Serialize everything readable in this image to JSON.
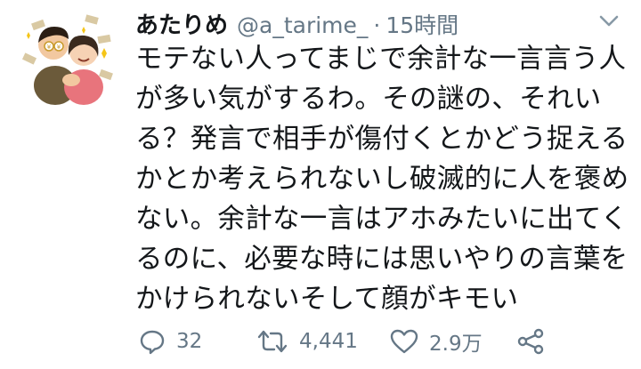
{
  "user": {
    "display_name": "あたりめ",
    "handle": "@a_tarime_",
    "separator": "·",
    "time": "15時間"
  },
  "tweet": {
    "lines": [
      "モテない人ってまじで余計な一言言う人",
      "が多い気がするわ。その謎の、それい",
      "る？発言で相手が傷付くとかどう捉える",
      "かとか考えられないし破滅的に人を褒め",
      "ない。余計な一言はアホみたいに出てく",
      "るのに、必要な時には思いやりの言葉を",
      "かけられないそして顔がキモい"
    ]
  },
  "actions": {
    "reply_count": "32",
    "retweet_count": "4,441",
    "like_count": "2.9万"
  },
  "icons": {
    "avatar": "avatar-illustration",
    "caret": "chevron-down-icon",
    "reply": "reply-icon",
    "retweet": "retweet-icon",
    "like": "heart-icon",
    "share": "share-icon"
  },
  "colors": {
    "text": "#14171a",
    "secondary": "#657786"
  }
}
